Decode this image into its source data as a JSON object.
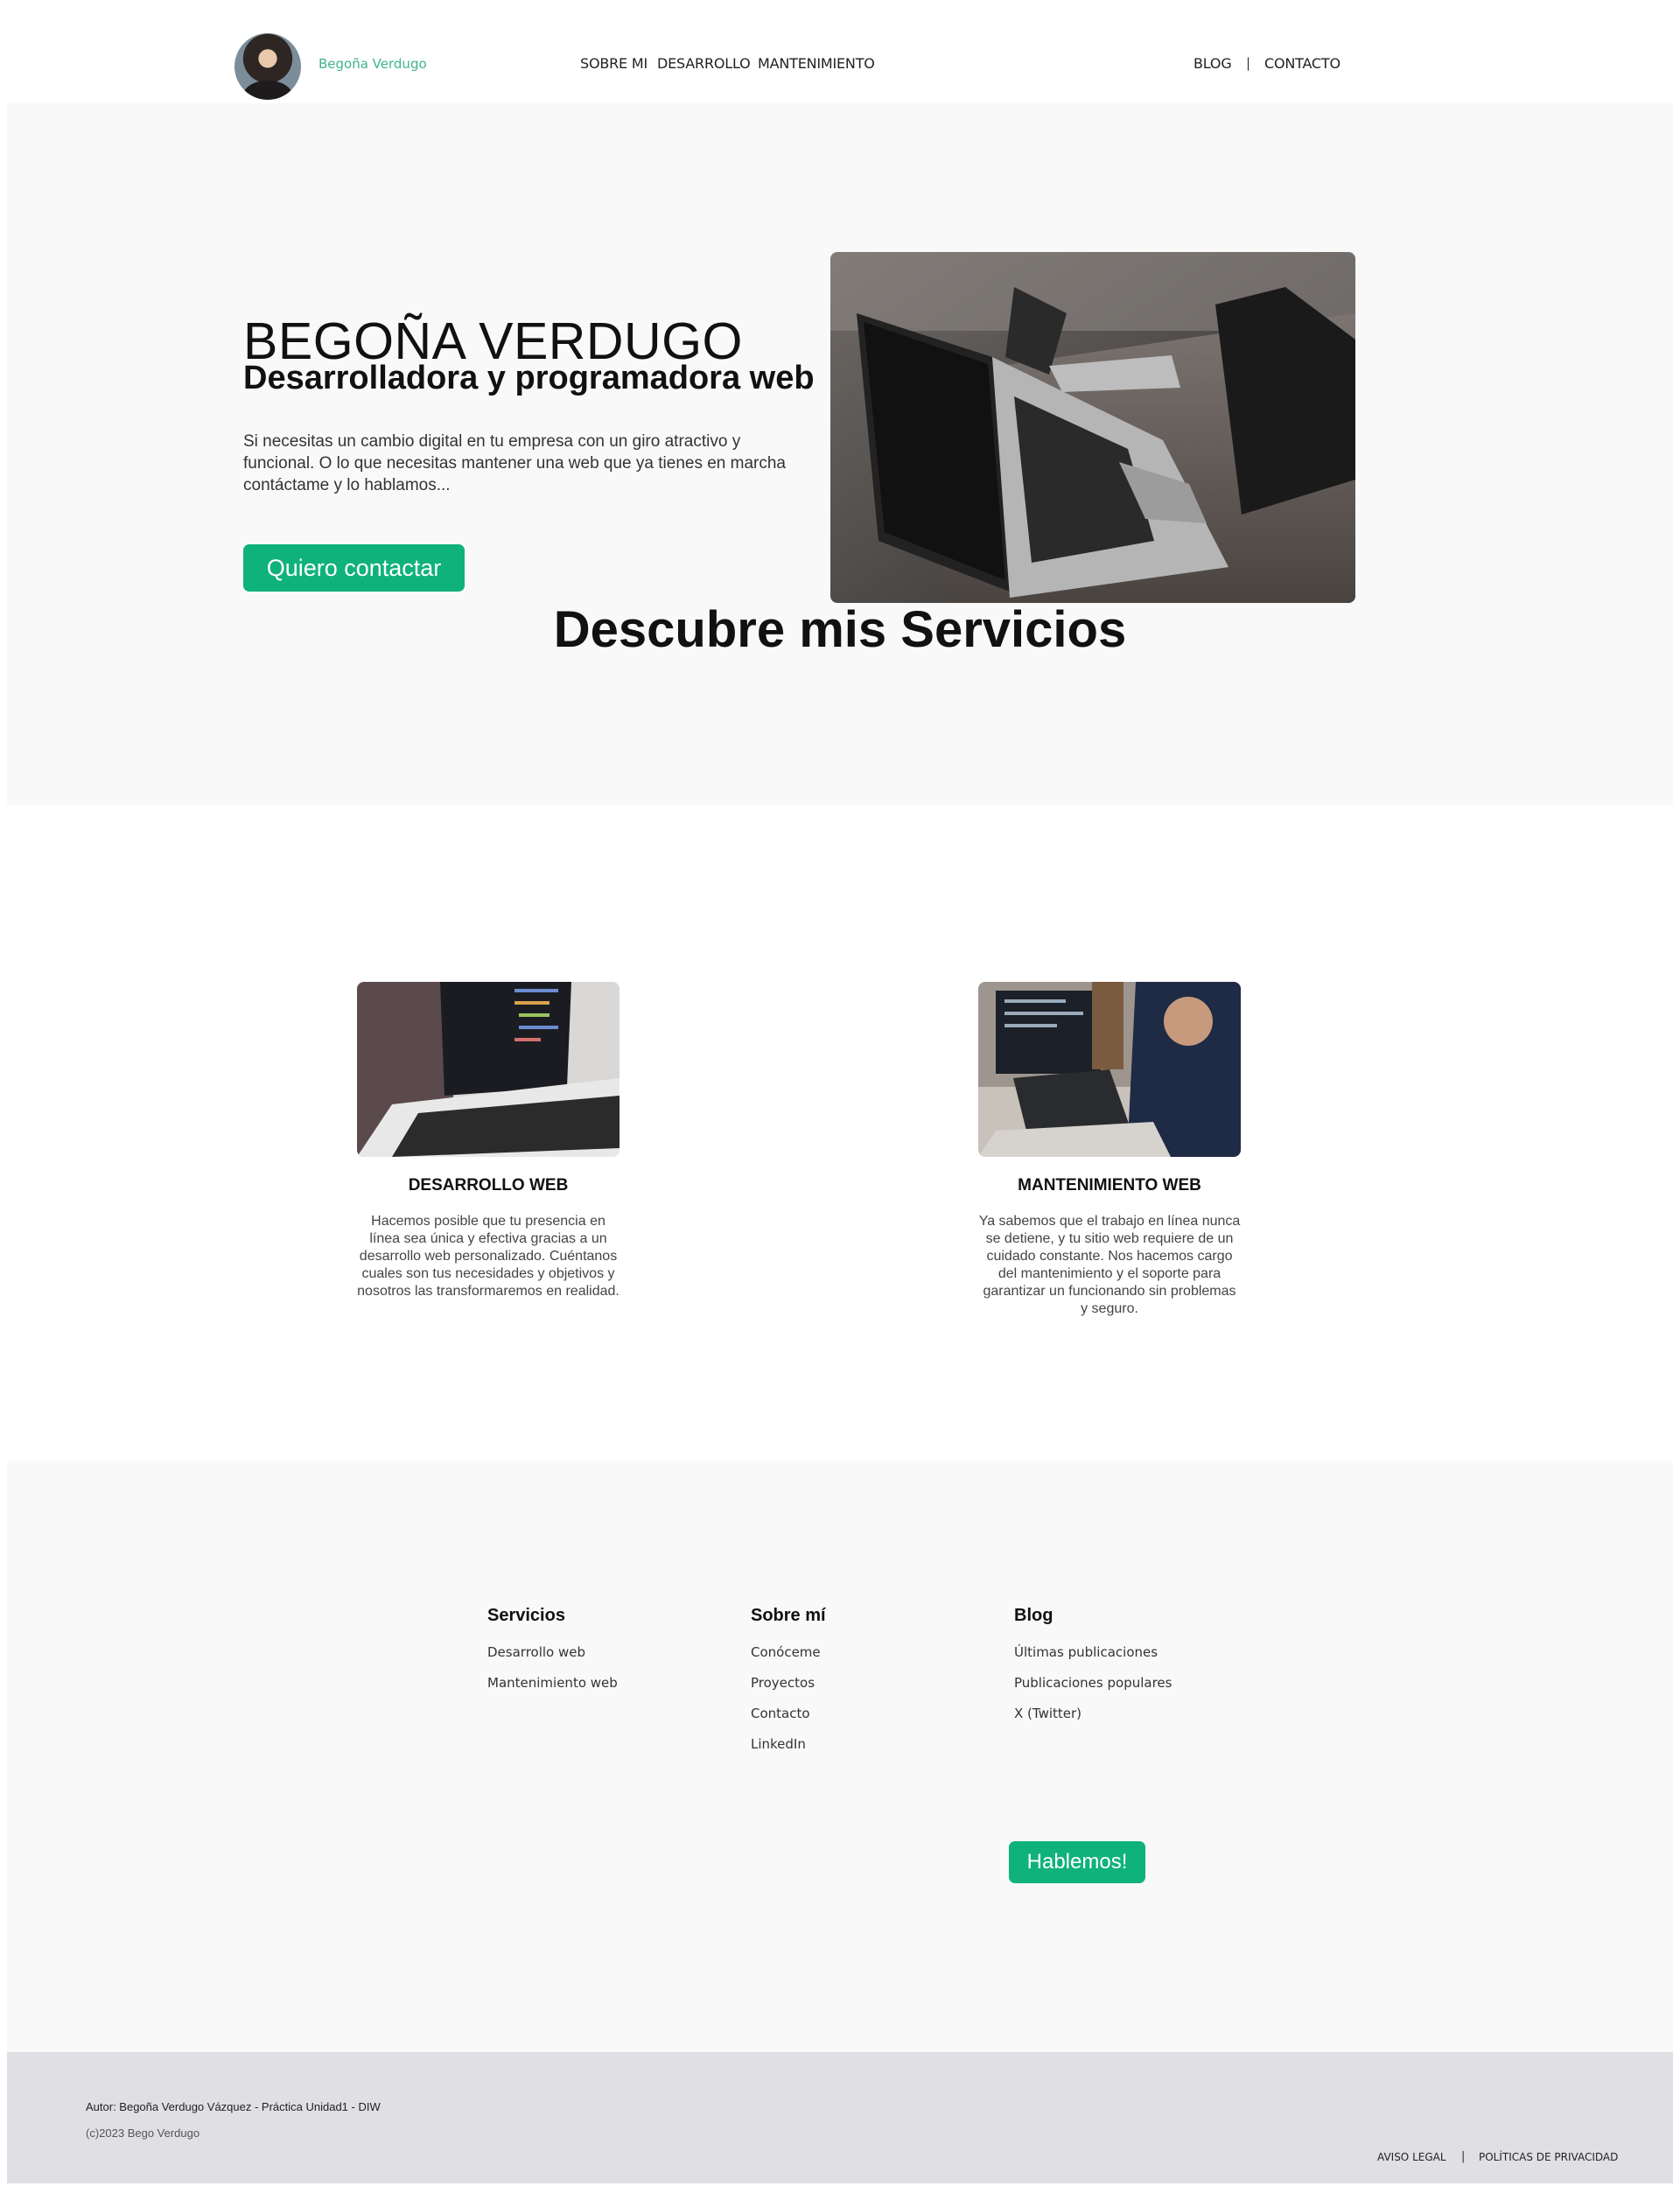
{
  "header": {
    "brand": "Begoña Verdugo",
    "nav_left": [
      "SOBRE MI",
      "DESARROLLO",
      "MANTENIMIENTO"
    ],
    "nav_right": [
      "BLOG",
      "CONTACTO"
    ],
    "separator": "|"
  },
  "hero": {
    "title": "BEGOÑA VERDUGO",
    "subtitle": "Desarrolladora y programadora web",
    "text": "Si necesitas un cambio digital en tu empresa con un giro atractivo y funcional. O lo que necesitas mantener una web que ya tienes en marcha contáctame y lo hablamos...",
    "button": "Quiero contactar"
  },
  "services": {
    "title": "Descubre mis Servicios",
    "items": [
      {
        "name": "DESARROLLO WEB",
        "description": "Hacemos posible que tu presencia en línea sea única y efectiva gracias a un desarrollo web personalizado. Cuéntanos cuales son tus necesidades y objetivos y nosotros las transformaremos en realidad."
      },
      {
        "name": "MANTENIMIENTO WEB",
        "description": "Ya sabemos que el trabajo en línea nunca se detiene, y tu sitio web requiere de un cuidado constante. Nos hacemos cargo del mantenimiento y el soporte para garantizar un funcionando sin problemas y seguro."
      }
    ]
  },
  "footer_links": {
    "columns": [
      {
        "title": "Servicios",
        "links": [
          "Desarrollo web",
          "Mantenimiento web"
        ]
      },
      {
        "title": "Sobre mí",
        "links": [
          "Conóceme",
          "Proyectos",
          "Contacto",
          "LinkedIn"
        ]
      },
      {
        "title": "Blog",
        "links": [
          "Últimas publicaciones",
          "Publicaciones populares",
          "X (Twitter)"
        ]
      }
    ],
    "button": "Hablemos!"
  },
  "bottom": {
    "author": "Autor: Begoña Verdugo Vázquez - Práctica Unidad1 - DIW",
    "copyright": "(c)2023 Bego Verdugo",
    "legal_links": [
      "AVISO LEGAL",
      "POLÍTICAS DE PRIVACIDAD"
    ],
    "separator": "|"
  },
  "colors": {
    "accent": "#0fb27a",
    "brand_text": "#3fb587",
    "section_bg": "#f9f9f9",
    "bottom_bg": "#e0e0e4"
  }
}
